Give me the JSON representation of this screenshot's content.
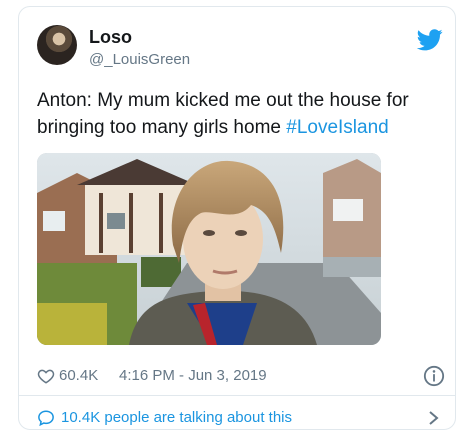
{
  "author": {
    "name": "Loso",
    "handle": "@_LouisGreen"
  },
  "tweet": {
    "text": "Anton: My mum kicked me out the house for bringing too many girls home ",
    "hashtag": "#LoveIsland"
  },
  "meta": {
    "likes": "60.4K",
    "timestamp": "4:16 PM - Jun 3, 2019"
  },
  "talk": {
    "label": "10.4K people are talking about this"
  },
  "icons": {
    "logo": "twitter-bird-icon",
    "like": "heart-icon",
    "info": "info-icon",
    "reply": "speech-bubble-icon",
    "more": "chevron-right-icon"
  },
  "colors": {
    "accent": "#1b95e0",
    "bird": "#1da1f2",
    "secondary_text": "#657786",
    "border": "#e1e8ed"
  }
}
